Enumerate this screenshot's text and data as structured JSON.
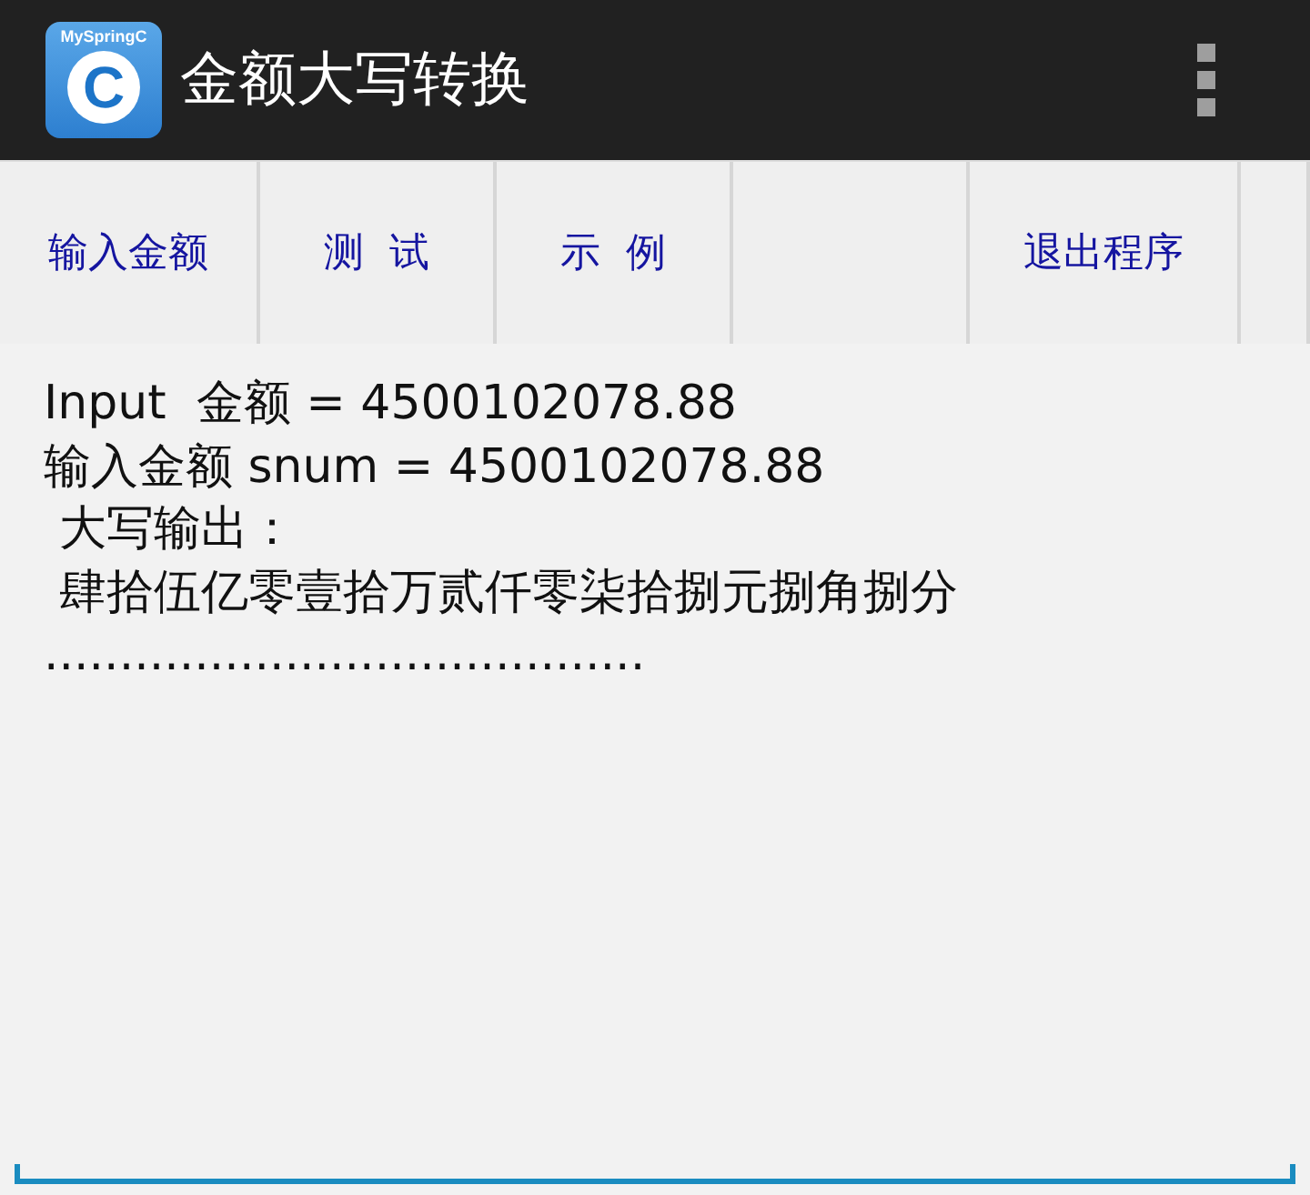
{
  "action_bar": {
    "app_icon": {
      "caption": "MySpringC",
      "letter": "C"
    },
    "title": "金额大写转换",
    "overflow_menu": true
  },
  "buttons": [
    {
      "kind": "text",
      "label": "输入金额"
    },
    {
      "kind": "text",
      "label": "测  试"
    },
    {
      "kind": "text",
      "label": "示  例"
    },
    {
      "kind": "blank"
    },
    {
      "kind": "text",
      "label": "退出程序"
    },
    {
      "kind": "blank"
    }
  ],
  "output": {
    "lines": [
      "Input  金额 = 4500102078.88",
      "输入金额 snum = 4500102078.88",
      " 大写输出：",
      " 肆拾伍亿零壹拾万贰仟零柒拾捌元捌角捌分",
      "........................................"
    ]
  }
}
